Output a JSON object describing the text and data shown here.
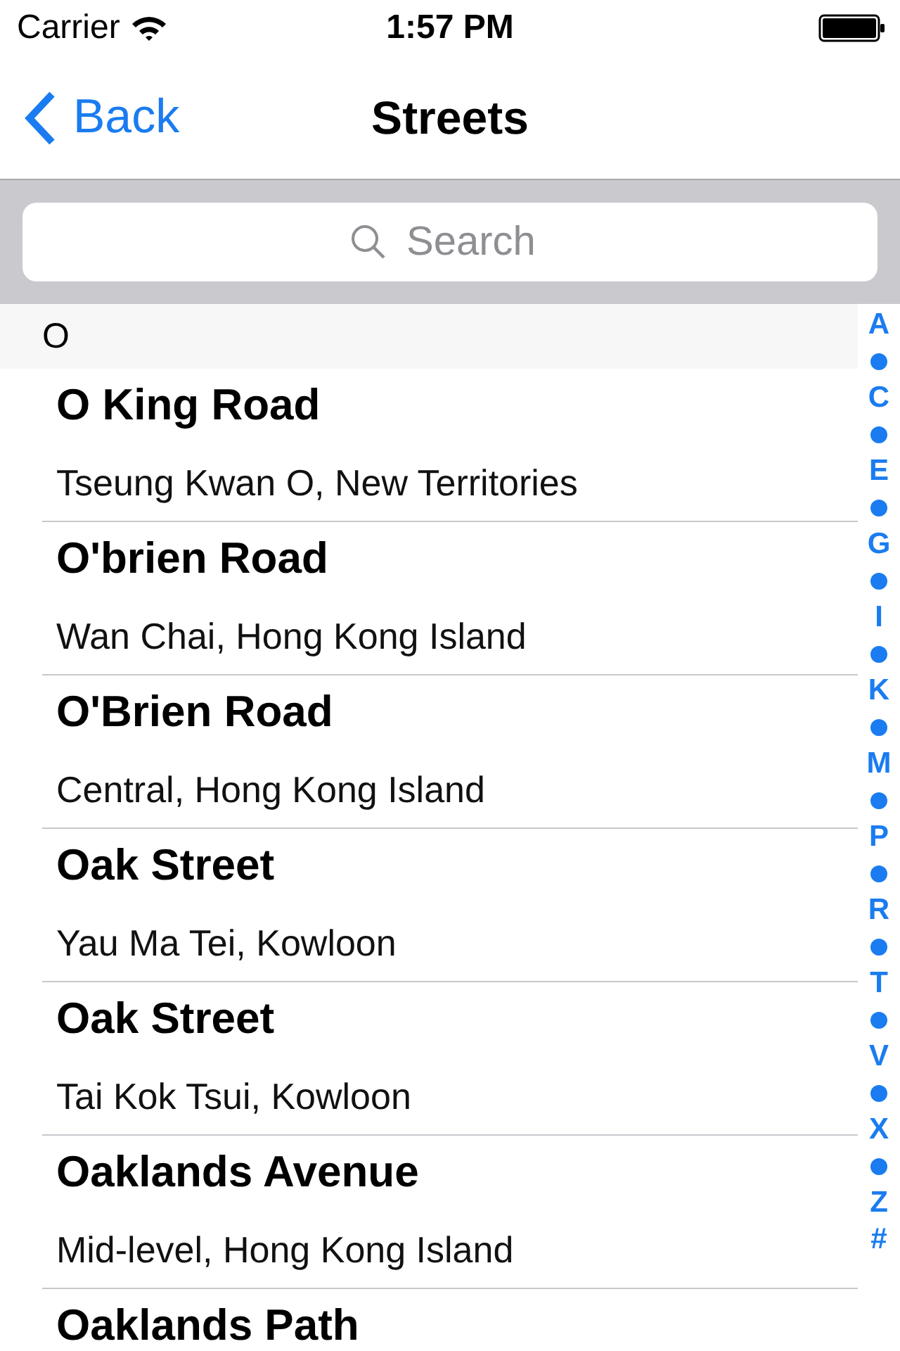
{
  "status_bar": {
    "carrier": "Carrier",
    "time": "1:57 PM"
  },
  "nav": {
    "back": "Back",
    "title": "Streets"
  },
  "search": {
    "placeholder": "Search"
  },
  "section": {
    "header": "O"
  },
  "rows": [
    {
      "name": "O King Road",
      "area": "Tseung Kwan O, New Territories"
    },
    {
      "name": "O'brien Road",
      "area": "Wan Chai, Hong Kong Island"
    },
    {
      "name": "O'Brien Road",
      "area": "Central, Hong Kong Island"
    },
    {
      "name": "Oak Street",
      "area": "Yau Ma Tei, Kowloon"
    },
    {
      "name": "Oak Street",
      "area": "Tai Kok Tsui, Kowloon"
    },
    {
      "name": "Oaklands Avenue",
      "area": "Mid-level, Hong Kong Island"
    },
    {
      "name": "Oaklands Path"
    }
  ],
  "index": [
    {
      "kind": "letter",
      "label": "A"
    },
    {
      "kind": "dot"
    },
    {
      "kind": "letter",
      "label": "C"
    },
    {
      "kind": "dot"
    },
    {
      "kind": "letter",
      "label": "E"
    },
    {
      "kind": "dot"
    },
    {
      "kind": "letter",
      "label": "G"
    },
    {
      "kind": "dot"
    },
    {
      "kind": "letter",
      "label": "I"
    },
    {
      "kind": "dot"
    },
    {
      "kind": "letter",
      "label": "K"
    },
    {
      "kind": "dot"
    },
    {
      "kind": "letter",
      "label": "M"
    },
    {
      "kind": "dot"
    },
    {
      "kind": "letter",
      "label": "P"
    },
    {
      "kind": "dot"
    },
    {
      "kind": "letter",
      "label": "R"
    },
    {
      "kind": "dot"
    },
    {
      "kind": "letter",
      "label": "T"
    },
    {
      "kind": "dot"
    },
    {
      "kind": "letter",
      "label": "V"
    },
    {
      "kind": "dot"
    },
    {
      "kind": "letter",
      "label": "X"
    },
    {
      "kind": "dot"
    },
    {
      "kind": "letter",
      "label": "Z"
    },
    {
      "kind": "letter",
      "label": "#"
    }
  ]
}
